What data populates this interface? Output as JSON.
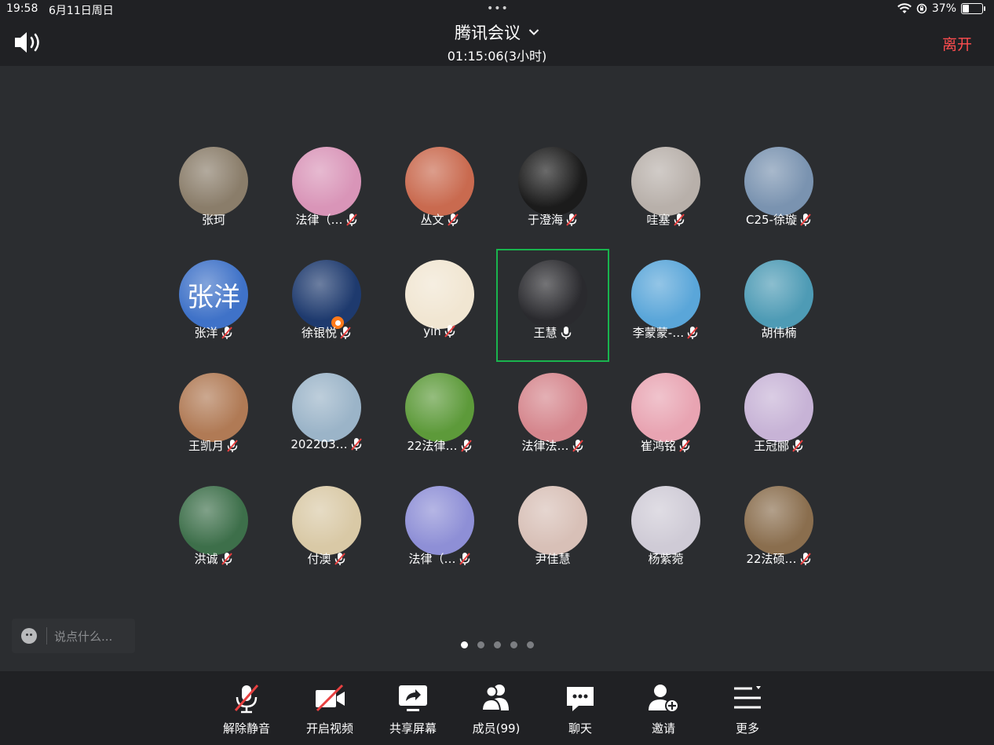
{
  "status_bar": {
    "time": "19:58",
    "date": "6月11日周日",
    "dots": "•••",
    "battery": "37%",
    "battery_level": 0.37
  },
  "header": {
    "title": "腾讯会议",
    "timer": "01:15:06(3小时)",
    "leave": "离开"
  },
  "participants": [
    {
      "name": "张珂",
      "muted": false,
      "show_mic": false,
      "bg": "#8a7d6a",
      "avatar_text": ""
    },
    {
      "name": "法律（…",
      "muted": true,
      "show_mic": true,
      "bg": "#d995b8",
      "avatar_text": ""
    },
    {
      "name": "丛文",
      "muted": true,
      "show_mic": true,
      "bg": "#c96a4f",
      "avatar_text": ""
    },
    {
      "name": "于澄海",
      "muted": true,
      "show_mic": true,
      "bg": "#1b1b1b",
      "avatar_text": ""
    },
    {
      "name": "哇塞",
      "muted": true,
      "show_mic": true,
      "bg": "#b8b0aa",
      "avatar_text": ""
    },
    {
      "name": "C25-徐璇",
      "muted": true,
      "show_mic": true,
      "bg": "#7a93b0",
      "avatar_text": ""
    },
    {
      "name": "张洋",
      "muted": true,
      "show_mic": true,
      "bg": "#3f72c8",
      "avatar_text": "张洋"
    },
    {
      "name": "徐银悦",
      "muted": true,
      "show_mic": true,
      "bg": "#1e3a6e",
      "avatar_text": "",
      "host": true
    },
    {
      "name": "yin",
      "muted": true,
      "show_mic": true,
      "bg": "#f1e6d2",
      "avatar_text": ""
    },
    {
      "name": "王慧",
      "muted": false,
      "show_mic": true,
      "active": true,
      "bg": "#2a2a2e",
      "avatar_text": ""
    },
    {
      "name": "李蒙蒙-…",
      "muted": true,
      "show_mic": true,
      "bg": "#5aa6d9",
      "avatar_text": ""
    },
    {
      "name": "胡伟楠",
      "muted": false,
      "show_mic": false,
      "bg": "#4e9bb5",
      "avatar_text": ""
    },
    {
      "name": "王凯月",
      "muted": true,
      "show_mic": true,
      "bg": "#b07a55",
      "avatar_text": ""
    },
    {
      "name": "202203…",
      "muted": true,
      "show_mic": true,
      "bg": "#9bb4c8",
      "avatar_text": ""
    },
    {
      "name": "22法律…",
      "muted": true,
      "show_mic": true,
      "bg": "#5d9a3a",
      "avatar_text": ""
    },
    {
      "name": "法律法…",
      "muted": true,
      "show_mic": true,
      "bg": "#d5868d",
      "avatar_text": ""
    },
    {
      "name": "崔鸿铭",
      "muted": true,
      "show_mic": true,
      "bg": "#e8a4b2",
      "avatar_text": ""
    },
    {
      "name": "王冠郦",
      "muted": true,
      "show_mic": true,
      "bg": "#c7b3d6",
      "avatar_text": ""
    },
    {
      "name": "洪诚",
      "muted": true,
      "show_mic": true,
      "bg": "#3d6f4a",
      "avatar_text": ""
    },
    {
      "name": "付澳",
      "muted": true,
      "show_mic": true,
      "bg": "#d9c9a6",
      "avatar_text": ""
    },
    {
      "name": "法律（…",
      "muted": true,
      "show_mic": true,
      "bg": "#8e8fd6",
      "avatar_text": ""
    },
    {
      "name": "尹佳慧",
      "muted": false,
      "show_mic": false,
      "bg": "#d8c0b7",
      "avatar_text": ""
    },
    {
      "name": "杨紫菀",
      "muted": false,
      "show_mic": false,
      "bg": "#cfcbd6",
      "avatar_text": ""
    },
    {
      "name": "22法硕…",
      "muted": true,
      "show_mic": true,
      "bg": "#8a6e4e",
      "avatar_text": ""
    }
  ],
  "chat": {
    "placeholder": "说点什么..."
  },
  "pager": {
    "count": 5,
    "current": 0
  },
  "toolbar": {
    "unmute": "解除静音",
    "video": "开启视频",
    "share": "共享屏幕",
    "members": "成员(99)",
    "chat": "聊天",
    "invite": "邀请",
    "more": "更多"
  },
  "colors": {
    "accent_green": "#19b44e",
    "leave_red": "#ff4d4f",
    "mute_red": "#e84040"
  }
}
